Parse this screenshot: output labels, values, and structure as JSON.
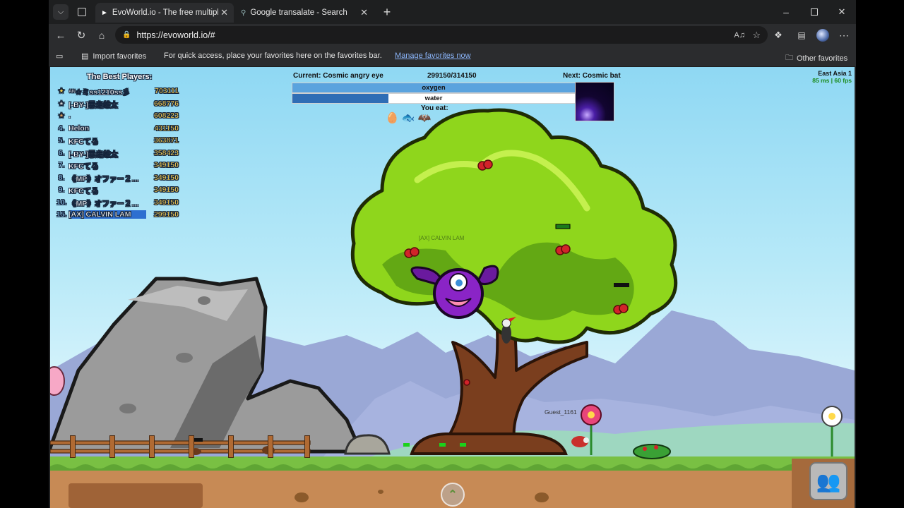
{
  "browser": {
    "tabs": [
      {
        "title": "EvoWorld.io - The free multiplayer",
        "active": true,
        "icon": "evoworld-favicon-icon"
      },
      {
        "title": "Google transalate - Search",
        "active": false,
        "icon": "search-icon"
      }
    ],
    "url": "https://evoworld.io/#",
    "favorites_bar": {
      "import_label": "Import favorites",
      "hint_text": "For quick access, place your favorites here on the favorites bar.",
      "manage_link": "Manage favorites now",
      "other_label": "Other favorites"
    },
    "colors": {
      "chrome_bg": "#1e1f20",
      "toolbar_bg": "#2b2c2e",
      "link": "#8ab4f8"
    }
  },
  "game": {
    "leaderboard": {
      "title": "The Best Players:",
      "rows": [
        {
          "rank": "★",
          "name": "ᴬᴺ☆ミss1210ss彡",
          "score": "703111"
        },
        {
          "rank": "★",
          "name": "[-BY-]暴走雄太",
          "score": "668776"
        },
        {
          "rank": "★",
          "name": ".",
          "score": "608223"
        },
        {
          "rank": "4.",
          "name": "Helon",
          "score": "431150"
        },
        {
          "rank": "5.",
          "name": "KFCてる",
          "score": "363871"
        },
        {
          "rank": "6.",
          "name": "[-BY-]暴走雄太",
          "score": "358423"
        },
        {
          "rank": "7.",
          "name": "KFCてる",
          "score": "349150"
        },
        {
          "rank": "8.",
          "name": "《MP》オファー２…",
          "score": "349150"
        },
        {
          "rank": "9.",
          "name": "KFCてる",
          "score": "349150"
        },
        {
          "rank": "10.",
          "name": "《MP》オファー２…",
          "score": "349150"
        },
        {
          "rank": "15.",
          "name": "[AX] CALVIN LAM",
          "score": "299150"
        }
      ]
    },
    "evolution": {
      "current_label": "Current: Cosmic angry eye",
      "progress_text": "299150/314150",
      "next_label": "Next: Cosmic bat",
      "oxygen_label": "oxygen",
      "oxygen_level": 1.0,
      "water_label": "water",
      "water_level": 0.34,
      "you_eat_label": "You eat:"
    },
    "server": {
      "region": "East Asia 1",
      "stats": "85 ms | 60 fps"
    },
    "player_names": {
      "self": "[AX] CALVIN LAM",
      "other": "Guest_1161"
    },
    "colors": {
      "sky": "#a9e4f6",
      "grass": "#7cc242",
      "dirt": "#c98b54",
      "tree_leaves": "#8ed61e",
      "player": "#7a1fb0"
    }
  }
}
